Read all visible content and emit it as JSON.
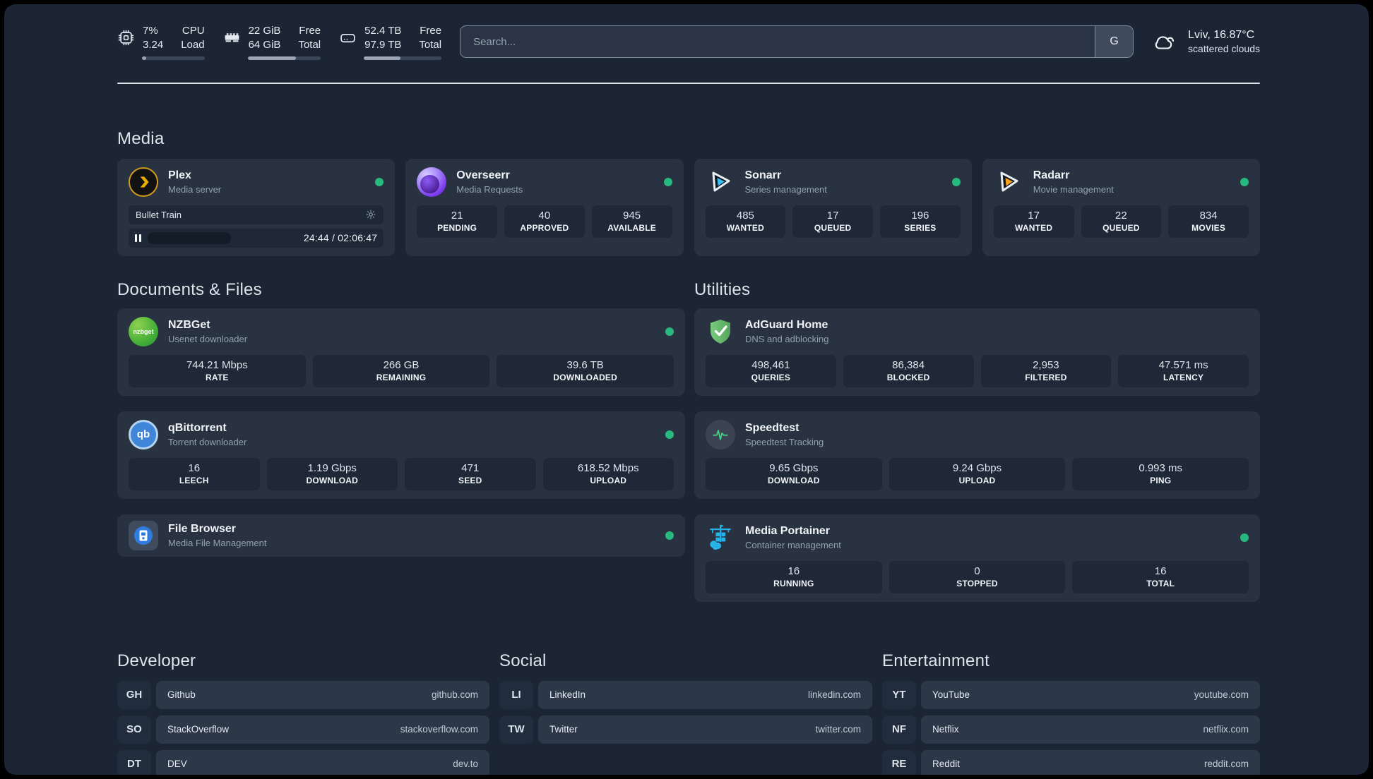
{
  "colors": {
    "status_online": "#27b97e",
    "plex_accent": "#ebaf00",
    "sonarr_accent": "#34c3f1",
    "radarr_accent": "#f6a21c",
    "portainer_accent": "#29b2e8"
  },
  "topbar": {
    "cpu": {
      "line1": "7%",
      "line2": "3.24",
      "label1": "CPU",
      "label2": "Load",
      "progress_pct": 7
    },
    "memory": {
      "line1": "22 GiB",
      "line2": "64 GiB",
      "label1": "Free",
      "label2": "Total",
      "progress_pct": 66
    },
    "storage": {
      "line1": "52.4 TB",
      "line2": "97.9 TB",
      "label1": "Free",
      "label2": "Total",
      "progress_pct": 47
    },
    "search": {
      "placeholder": "Search...",
      "engine_label": "G"
    },
    "weather": {
      "title": "Lviv, 16.87°C",
      "subtitle": "scattered clouds"
    }
  },
  "media": {
    "title": "Media",
    "plex": {
      "name": "Plex",
      "subtitle": "Media server",
      "now_playing": "Bullet Train",
      "time": "24:44 / 02:06:47"
    },
    "overseerr": {
      "name": "Overseerr",
      "subtitle": "Media Requests",
      "stats": [
        {
          "value": "21",
          "label": "PENDING"
        },
        {
          "value": "40",
          "label": "APPROVED"
        },
        {
          "value": "945",
          "label": "AVAILABLE"
        }
      ]
    },
    "sonarr": {
      "name": "Sonarr",
      "subtitle": "Series management",
      "stats": [
        {
          "value": "485",
          "label": "WANTED"
        },
        {
          "value": "17",
          "label": "QUEUED"
        },
        {
          "value": "196",
          "label": "SERIES"
        }
      ]
    },
    "radarr": {
      "name": "Radarr",
      "subtitle": "Movie management",
      "stats": [
        {
          "value": "17",
          "label": "WANTED"
        },
        {
          "value": "22",
          "label": "QUEUED"
        },
        {
          "value": "834",
          "label": "MOVIES"
        }
      ]
    }
  },
  "documents": {
    "title": "Documents & Files",
    "nzbget": {
      "name": "NZBGet",
      "subtitle": "Usenet downloader",
      "stats": [
        {
          "value": "744.21 Mbps",
          "label": "RATE"
        },
        {
          "value": "266 GB",
          "label": "REMAINING"
        },
        {
          "value": "39.6 TB",
          "label": "DOWNLOADED"
        }
      ]
    },
    "qbittorrent": {
      "name": "qBittorrent",
      "subtitle": "Torrent downloader",
      "stats": [
        {
          "value": "16",
          "label": "LEECH"
        },
        {
          "value": "1.19 Gbps",
          "label": "DOWNLOAD"
        },
        {
          "value": "471",
          "label": "SEED"
        },
        {
          "value": "618.52 Mbps",
          "label": "UPLOAD"
        }
      ]
    },
    "filebrowser": {
      "name": "File Browser",
      "subtitle": "Media File Management"
    }
  },
  "utilities": {
    "title": "Utilities",
    "adguard": {
      "name": "AdGuard Home",
      "subtitle": "DNS and adblocking",
      "stats": [
        {
          "value": "498,461",
          "label": "QUERIES"
        },
        {
          "value": "86,384",
          "label": "BLOCKED"
        },
        {
          "value": "2,953",
          "label": "FILTERED"
        },
        {
          "value": "47.571 ms",
          "label": "LATENCY"
        }
      ]
    },
    "speedtest": {
      "name": "Speedtest",
      "subtitle": "Speedtest Tracking",
      "stats": [
        {
          "value": "9.65 Gbps",
          "label": "DOWNLOAD"
        },
        {
          "value": "9.24 Gbps",
          "label": "UPLOAD"
        },
        {
          "value": "0.993 ms",
          "label": "PING"
        }
      ]
    },
    "portainer": {
      "name": "Media Portainer",
      "subtitle": "Container management",
      "stats": [
        {
          "value": "16",
          "label": "RUNNING"
        },
        {
          "value": "0",
          "label": "STOPPED"
        },
        {
          "value": "16",
          "label": "TOTAL"
        }
      ]
    }
  },
  "links": {
    "developer": {
      "title": "Developer",
      "items": [
        {
          "abbr": "GH",
          "name": "Github",
          "domain": "github.com"
        },
        {
          "abbr": "SO",
          "name": "StackOverflow",
          "domain": "stackoverflow.com"
        },
        {
          "abbr": "DT",
          "name": "DEV",
          "domain": "dev.to"
        }
      ]
    },
    "social": {
      "title": "Social",
      "items": [
        {
          "abbr": "LI",
          "name": "LinkedIn",
          "domain": "linkedin.com"
        },
        {
          "abbr": "TW",
          "name": "Twitter",
          "domain": "twitter.com"
        }
      ]
    },
    "entertainment": {
      "title": "Entertainment",
      "items": [
        {
          "abbr": "YT",
          "name": "YouTube",
          "domain": "youtube.com"
        },
        {
          "abbr": "NF",
          "name": "Netflix",
          "domain": "netflix.com"
        },
        {
          "abbr": "RE",
          "name": "Reddit",
          "domain": "reddit.com"
        }
      ]
    }
  }
}
